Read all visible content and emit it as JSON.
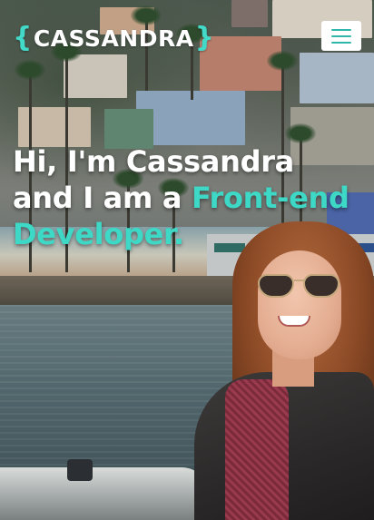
{
  "header": {
    "logo_left_brace": "{",
    "logo_text": "CASSANDRA",
    "logo_right_brace": "}",
    "menu_icon": "hamburger-icon"
  },
  "hero": {
    "line1": "Hi, I'm Cassandra",
    "line2_prefix": "and I am a ",
    "line2_accent": "Front-end",
    "line3_accent": "Developer",
    "line3_suffix": "."
  },
  "colors": {
    "accent": "#3ed8c6",
    "text": "#ffffff",
    "menu_button_bg": "#ffffff"
  }
}
